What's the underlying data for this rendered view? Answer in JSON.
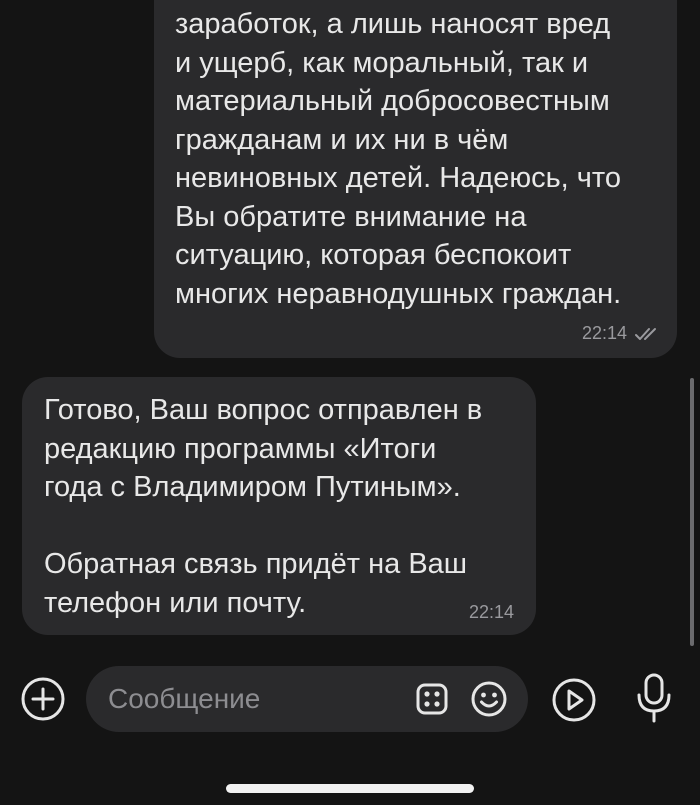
{
  "chat": {
    "outgoing": {
      "text": "заработок, а лишь наносят вред\nи ущерб, как моральный, так и\nматериальный добросовестным\nгражданам и их ни в чём\nневиновных детей. Надеюсь, что\nВы обратите внимание на\nситуацию, которая беспокоит\nмногих неравнодушных граждан.",
      "time": "22:14",
      "status_icon": "double-check-icon"
    },
    "incoming": {
      "text": "Готово, Ваш вопрос отправлен в\nредакцию программы «Итоги\nгода с Владимиром Путиным».\n\nОбратная связь придёт на Ваш\nтелефон или почту.",
      "time": "22:14"
    }
  },
  "composer": {
    "placeholder": "Сообщение",
    "add_icon": "plus-circle-icon",
    "sticker_icon": "dice-icon",
    "emoji_icon": "smiley-icon",
    "video_icon": "play-circle-icon",
    "mic_icon": "microphone-icon"
  },
  "colors": {
    "background": "#141414",
    "bubble": "#2a2a2c",
    "text": "#e8e8e8",
    "meta": "#9a9a9e"
  }
}
